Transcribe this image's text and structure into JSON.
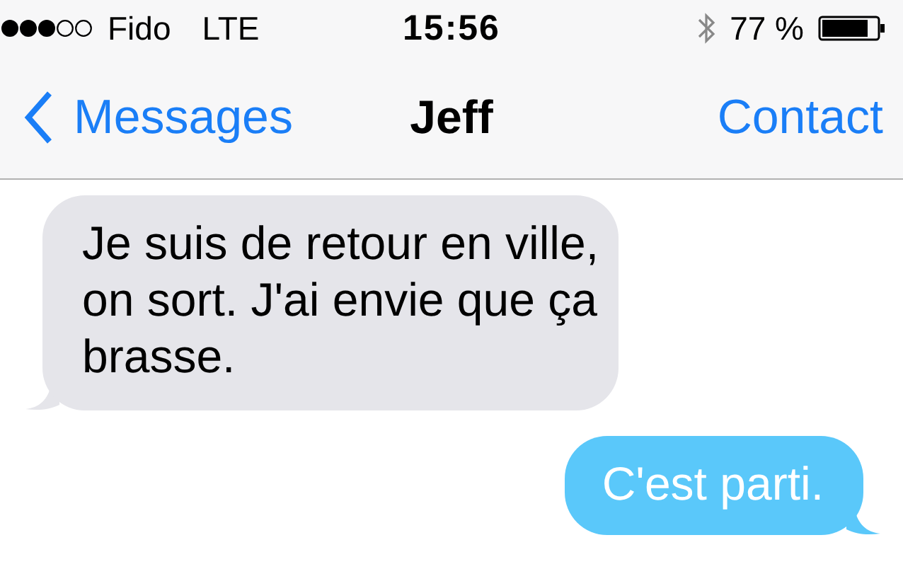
{
  "status_bar": {
    "carrier": "Fido",
    "network": "LTE",
    "time": "15:56",
    "battery": "77 %"
  },
  "nav_bar": {
    "back": "Messages",
    "title": "Jeff",
    "action": "Contact"
  },
  "messages": [
    {
      "kind": "incoming",
      "text": "Je suis de retour en ville, on sort. J'ai envie que ça brasse."
    },
    {
      "kind": "outgoing",
      "text": "C'est parti."
    }
  ]
}
